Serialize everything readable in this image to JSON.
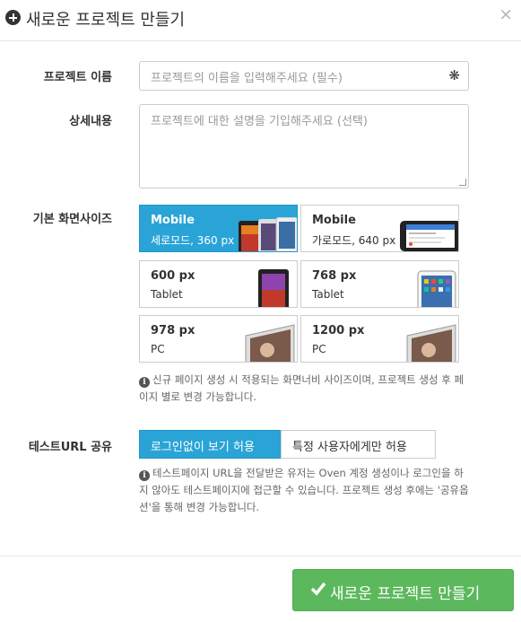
{
  "modal": {
    "title": "새로운 프로젝트 만들기",
    "close": "×"
  },
  "form": {
    "name_label": "프로젝트 이름",
    "name_placeholder": "프로젝트의 이름을 입력해주세요 (필수)",
    "name_required": "❋",
    "desc_label": "상세내용",
    "desc_placeholder": "프로젝트에 대한 설명을 기입해주세요 (선택)",
    "size_label": "기본 화면사이즈",
    "sizes": [
      {
        "line1": "Mobile",
        "line2": "세로모드, 360 px",
        "selected": true
      },
      {
        "line1": "Mobile",
        "line2": "가로모드, 640 px",
        "selected": false
      },
      {
        "line1": "600 px",
        "line2": "Tablet",
        "selected": false
      },
      {
        "line1": "768 px",
        "line2": "Tablet",
        "selected": false
      },
      {
        "line1": "978 px",
        "line2": "PC",
        "selected": false
      },
      {
        "line1": "1200 px",
        "line2": "PC",
        "selected": false
      }
    ],
    "size_help": "신규 페이지 생성 시 적용되는 화면너비 사이즈이며, 프로젝트 생성 후 페이지 별로 변경 가능합니다.",
    "share_label": "테스트URL 공유",
    "share_options": [
      "로그인없이 보기 허용",
      "특정 사용자에게만 허용"
    ],
    "share_help": "테스트페이지 URL을 전달받은 유저는 Oven 계정 생성이나 로그인을 하지 않아도 테스트페이지에 접근할 수 있습니다. 프로젝트 생성 후에는 '공유옵션'을 통해 변경 가능합니다."
  },
  "footer": {
    "create_label": "새로운 프로젝트 만들기"
  },
  "colors": {
    "selected_blue": "#2aa4d6",
    "create_green": "#5cb85c"
  },
  "icons": [
    "plus-circle-icon",
    "close-icon",
    "required-asterisk-icon",
    "info-icon",
    "check-icon"
  ]
}
